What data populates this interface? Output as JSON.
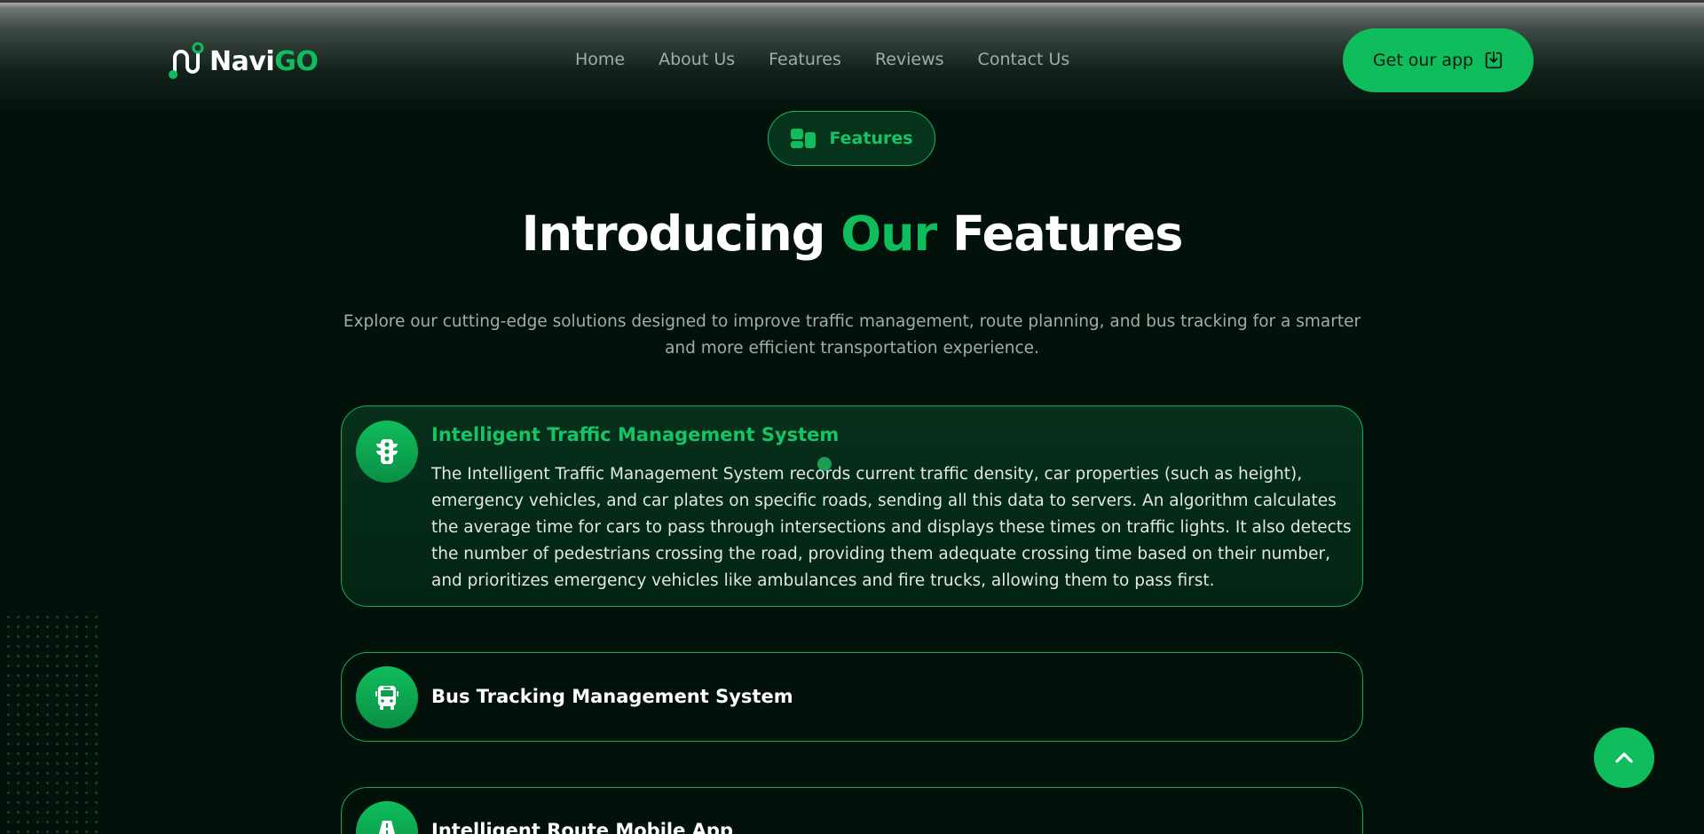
{
  "brand": {
    "name_part1": "Navi",
    "name_part2": "GO",
    "accent_color": "#0fbd5c",
    "background_color": "#021109"
  },
  "nav": {
    "items": [
      {
        "label": "Home"
      },
      {
        "label": "About Us"
      },
      {
        "label": "Features"
      },
      {
        "label": "Reviews"
      },
      {
        "label": "Contact Us"
      }
    ]
  },
  "cta": {
    "label": "Get our app",
    "icon": "download-icon"
  },
  "section": {
    "badge_label": "Features",
    "badge_icon": "dashboard-icon",
    "heading_part1": "Introducing ",
    "heading_highlight": "Our",
    "heading_part2": " Features",
    "subtitle": "Explore our cutting-edge solutions designed to improve traffic management, route planning, and bus tracking for a smarter and more efficient transportation experience."
  },
  "features": [
    {
      "title": "Intelligent Traffic Management System",
      "icon": "traffic-light-icon",
      "expanded": true,
      "description": "The Intelligent Traffic Management System records current traffic density, car properties (such as height), emergency vehicles, and car plates on specific roads, sending all this data to servers. An algorithm calculates the average time for cars to pass through intersections and displays these times on traffic lights. It also detects the number of pedestrians crossing the road, providing them adequate crossing time based on their number, and prioritizes emergency vehicles like ambulances and fire trucks, allowing them to pass first."
    },
    {
      "title": "Bus Tracking Management System",
      "icon": "bus-icon",
      "expanded": false
    },
    {
      "title": "Intelligent Route Mobile App",
      "icon": "road-icon",
      "expanded": false
    }
  ],
  "scroll_top": {
    "icon": "chevron-up-icon"
  }
}
